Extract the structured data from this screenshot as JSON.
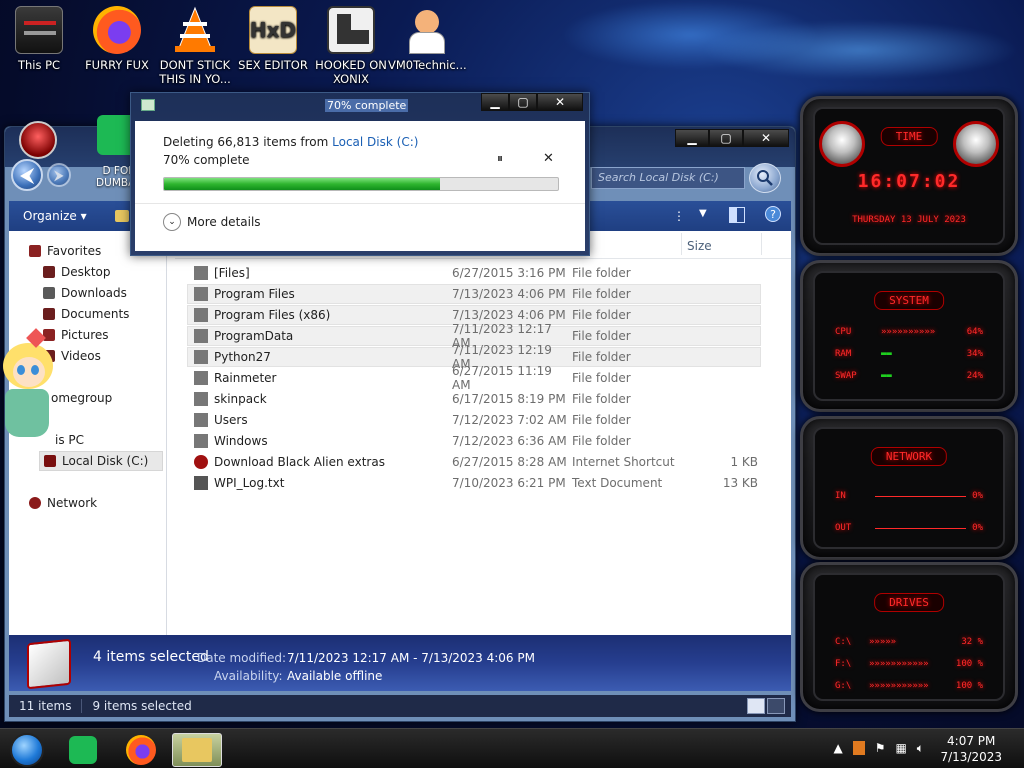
{
  "desktop": {
    "icons": [
      {
        "label": "This PC",
        "icon": "this-pc-icon"
      },
      {
        "label": "FURRY FUX",
        "icon": "firefox-icon"
      },
      {
        "label": "DONT STICK THIS IN YO...",
        "icon": "vlc-icon"
      },
      {
        "label": "SEX EDITOR",
        "icon": "hxd-icon"
      },
      {
        "label": "HOOKED ON XONIX",
        "icon": "xonix-icon"
      },
      {
        "label": "VM0Technic...",
        "icon": "doctor-icon"
      }
    ],
    "partial_icon_label": "D FOR DUMBAS"
  },
  "dialog": {
    "title": "70% complete",
    "heading_prefix": "Deleting 66,813 items from ",
    "heading_link": "Local Disk (C:)",
    "progress_text": "70% complete",
    "progress": 0.7,
    "pause_symbol": "⏸",
    "close_symbol": "✕",
    "more_details": "More details"
  },
  "explorer": {
    "search_placeholder": "Search Local Disk (C:)",
    "organize": "Organize ▾",
    "column_size": "Size",
    "column_type_partial": "e",
    "nav": {
      "favorites": "Favorites",
      "desktop": "Desktop",
      "downloads": "Downloads",
      "documents": "Documents",
      "pictures": "Pictures",
      "videos": "Videos",
      "homegroup": "omegroup",
      "this_pc": "is PC",
      "local_disk": "Local Disk (C:)",
      "network": "Network"
    },
    "files": [
      {
        "name": "[Files]",
        "date": "6/27/2015 3:16 PM",
        "type": "File folder",
        "size": "",
        "selected": false,
        "icon": "folder-icon"
      },
      {
        "name": "Program Files",
        "date": "7/13/2023 4:06 PM",
        "type": "File folder",
        "size": "",
        "selected": true,
        "icon": "folder-icon"
      },
      {
        "name": "Program Files (x86)",
        "date": "7/13/2023 4:06 PM",
        "type": "File folder",
        "size": "",
        "selected": true,
        "icon": "folder-icon"
      },
      {
        "name": "ProgramData",
        "date": "7/11/2023 12:17 AM",
        "type": "File folder",
        "size": "",
        "selected": true,
        "icon": "folder-icon"
      },
      {
        "name": "Python27",
        "date": "7/11/2023 12:19 AM",
        "type": "File folder",
        "size": "",
        "selected": true,
        "icon": "folder-icon"
      },
      {
        "name": "Rainmeter",
        "date": "6/27/2015 11:19 AM",
        "type": "File folder",
        "size": "",
        "selected": false,
        "icon": "folder-icon"
      },
      {
        "name": "skinpack",
        "date": "6/17/2015 8:19 PM",
        "type": "File folder",
        "size": "",
        "selected": false,
        "icon": "folder-icon"
      },
      {
        "name": "Users",
        "date": "7/12/2023 7:02 AM",
        "type": "File folder",
        "size": "",
        "selected": false,
        "icon": "folder-icon"
      },
      {
        "name": "Windows",
        "date": "7/12/2023 6:36 AM",
        "type": "File folder",
        "size": "",
        "selected": false,
        "icon": "folder-icon"
      },
      {
        "name": "Download Black Alien extras",
        "date": "6/27/2015 8:28 AM",
        "type": "Internet Shortcut",
        "size": "1 KB",
        "selected": false,
        "icon": "shortcut-icon"
      },
      {
        "name": "WPI_Log.txt",
        "date": "7/10/2023 6:21 PM",
        "type": "Text Document",
        "size": "13 KB",
        "selected": false,
        "icon": "text-file-icon"
      }
    ],
    "details": {
      "selected_count": "4 items selected",
      "date_label": "Date modified:",
      "date_value": "7/11/2023 12:17 AM - 7/13/2023 4:06 PM",
      "avail_label": "Availability:",
      "avail_value": "Available offline"
    },
    "status": {
      "items": "11 items",
      "selected": "9 items selected"
    }
  },
  "gadget": {
    "time_title": "TIME",
    "clock": "16:07:02",
    "date": "THURSDAY 13 JULY 2023",
    "system_title": "SYSTEM",
    "cpu_label": "CPU",
    "cpu_value": "64%",
    "ram_label": "RAM",
    "ram_value": "34%",
    "swap_label": "SWAP",
    "swap_value": "24%",
    "network_title": "NETWORK",
    "in_label": "IN",
    "in_value": "0%",
    "out_label": "OUT",
    "out_value": "0%",
    "drives_title": "DRIVES",
    "drives": [
      {
        "label": "C:\\",
        "value": "32 %"
      },
      {
        "label": "F:\\",
        "value": "100 %"
      },
      {
        "label": "G:\\",
        "value": "100 %"
      }
    ]
  },
  "taskbar": {
    "time": "4:07 PM",
    "date": "7/13/2023"
  }
}
